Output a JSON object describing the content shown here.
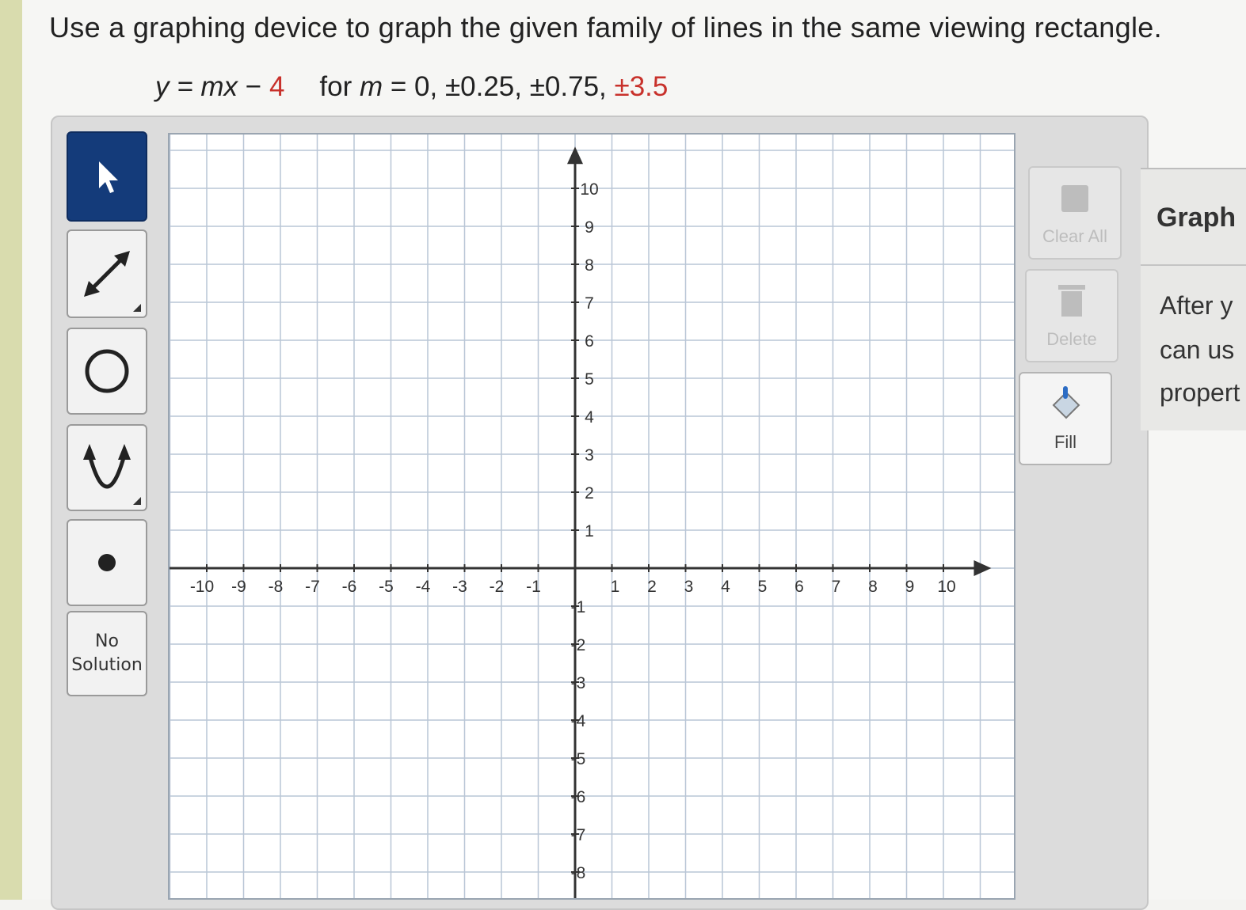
{
  "question": {
    "prompt": "Use a graphing device to graph the given family of lines in the same viewing rectangle.",
    "equation_lhs": "y = ",
    "equation_mx": "mx",
    "equation_minus": " − ",
    "equation_const": "4",
    "equation_for": "for ",
    "equation_m": "m",
    "equation_values": " = 0, ±0.25, ±0.75, ",
    "equation_last": "±3.5"
  },
  "toolbar": {
    "tools": [
      {
        "name": "pointer",
        "icon": "arrow-cursor-icon"
      },
      {
        "name": "line",
        "icon": "line-arrows-icon"
      },
      {
        "name": "circle",
        "icon": "circle-icon"
      },
      {
        "name": "parabola",
        "icon": "parabola-icon"
      },
      {
        "name": "point",
        "icon": "point-icon"
      }
    ],
    "no_solution_line1": "No",
    "no_solution_line2": "Solution"
  },
  "graph": {
    "x_labels": [
      "-10",
      "-9",
      "-8",
      "-7",
      "-6",
      "-5",
      "-4",
      "-3",
      "-2",
      "-1",
      "1",
      "2",
      "3",
      "4",
      "5",
      "6",
      "7",
      "8",
      "9",
      "10"
    ],
    "y_labels": [
      "10",
      "9",
      "8",
      "7",
      "6",
      "5",
      "4",
      "3",
      "2",
      "1",
      "-1",
      "-2",
      "-3",
      "-4",
      "-5",
      "-6",
      "-7",
      "-8"
    ],
    "x_range": [
      -10,
      10
    ],
    "y_visible_range": [
      -8,
      10
    ]
  },
  "right_tools": {
    "clear_all": "Clear All",
    "delete": "Delete",
    "fill": "Fill"
  },
  "side_panel": {
    "title": "Graph",
    "line1": "After y",
    "line2": "can us",
    "line3": "propert"
  },
  "colors": {
    "accent_red": "#c8312b",
    "active_tool": "#143b7a",
    "grid": "#b9c6d6"
  }
}
